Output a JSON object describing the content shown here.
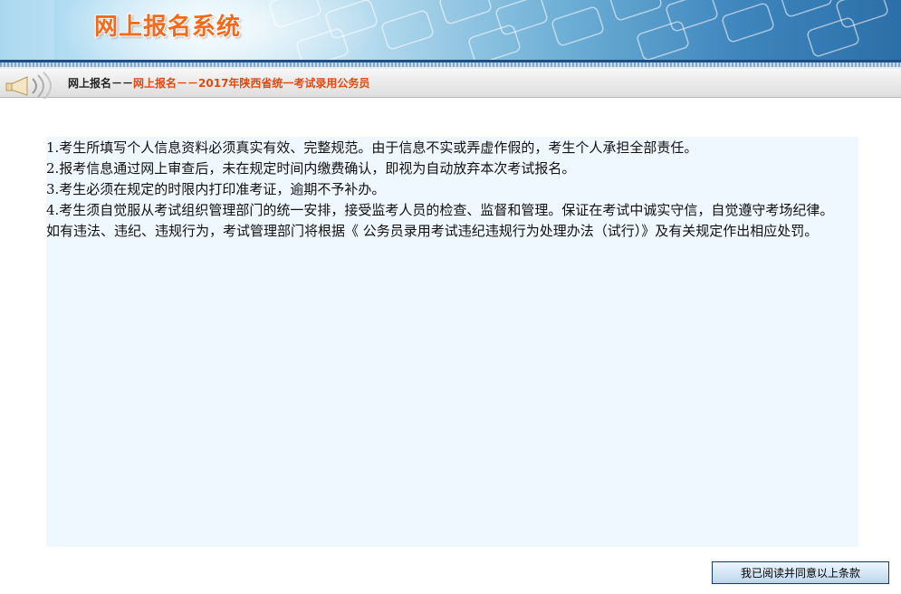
{
  "header": {
    "title": "网上报名系统",
    "title_color": "#f16a1e",
    "stripe_color": "#1d4f84"
  },
  "breadcrumb": {
    "home": "网上报名",
    "separator": "－－",
    "current": "网上报名－－2017年陕西省统一考试录用公务员",
    "icon": "horn-icon",
    "current_color": "#e04a12"
  },
  "notice": {
    "background": "#f0f8ff",
    "items": [
      "1.考生所填写个人信息资料必须真实有效、完整规范。由于信息不实或弄虚作假的，考生个人承担全部责任。",
      "2.报考信息通过网上审查后，未在规定时间内缴费确认，即视为自动放弃本次考试报名。",
      "3.考生必须在规定的时限内打印准考证，逾期不予补办。",
      "4.考生须自觉服从考试组织管理部门的统一安排，接受监考人员的检查、监督和管理。保证在考试中诚实守信，自觉遵守考场纪律。如有违法、违纪、违规行为，考试管理部门将根据《 公务员录用考试违纪违规行为处理办法（试行）》及有关规定作出相应处罚。"
    ]
  },
  "actions": {
    "agree_label": "我已阅读并同意以上条款"
  }
}
